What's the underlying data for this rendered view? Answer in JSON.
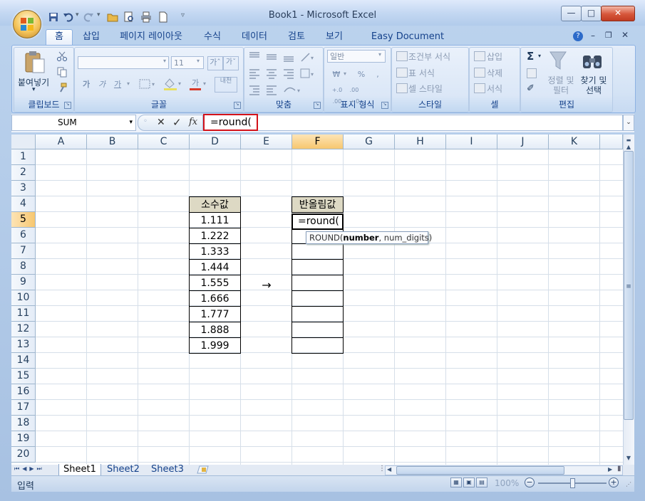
{
  "window": {
    "title": "Book1 - Microsoft Excel",
    "buttons": {
      "minimize": "—",
      "maximize": "□",
      "close": "✕"
    }
  },
  "quick_access": {
    "save": "save-icon",
    "undo": "undo-icon",
    "redo": "redo-icon",
    "open": "open-icon",
    "preview": "print-preview-icon",
    "print": "print-icon",
    "new": "new-document-icon"
  },
  "ribbon": {
    "tabs": [
      "홈",
      "삽입",
      "페이지 레이아웃",
      "수식",
      "데이터",
      "검토",
      "보기",
      "Easy Document Creator"
    ],
    "active_tab": "홈",
    "groups": {
      "clipboard": {
        "label": "클립보드",
        "paste": "붙여넣기",
        "paste_arrow": "▾"
      },
      "font": {
        "label": "글꼴",
        "font_name": "",
        "font_size": "11",
        "grow": "가ˆ",
        "shrink": "가ˇ",
        "bold": "가",
        "italic": "가",
        "underline": "가",
        "font_color_letter": "가",
        "phonetic": "내천"
      },
      "alignment": {
        "label": "맞춤"
      },
      "number": {
        "label": "표시 형식",
        "format": "일반",
        "currency": "₩",
        "percent": "%",
        "comma": ",",
        "inc_dec": "+.0 .00",
        "dec_dec": ".00 →.0"
      },
      "styles": {
        "label": "스타일",
        "conditional": "조건부 서식",
        "table": "표 서식",
        "cell_style": "셀 스타일"
      },
      "cells": {
        "label": "셀",
        "insert": "삽입",
        "delete": "삭제",
        "format": "서식"
      },
      "editing": {
        "label": "편집",
        "autosum": "Σ",
        "sort_filter": "정렬 및 필터",
        "find_select": "찾기 및 선택"
      }
    }
  },
  "formula_bar": {
    "name_box": "SUM",
    "cancel": "✕",
    "enter": "✓",
    "fx": "fx",
    "formula": "=round("
  },
  "grid": {
    "columns": [
      "A",
      "B",
      "C",
      "D",
      "E",
      "F",
      "G",
      "H",
      "I",
      "J",
      "K"
    ],
    "selected_column": "F",
    "rows": [
      "1",
      "2",
      "3",
      "4",
      "5",
      "6",
      "7",
      "8",
      "9",
      "10",
      "11",
      "12",
      "13",
      "14",
      "15",
      "16",
      "17",
      "18",
      "19",
      "20"
    ],
    "selected_row": "5",
    "decimal_header": "소수값",
    "rounded_header": "반올림값",
    "decimal_values": [
      "1.111",
      "1.222",
      "1.333",
      "1.444",
      "1.555",
      "1.666",
      "1.777",
      "1.888",
      "1.999"
    ],
    "arrow": "→",
    "active_cell_text": "=round(",
    "tooltip": {
      "func": "ROUND(",
      "arg1": "number",
      "rest": ", num_digits)"
    }
  },
  "sheet_tabs": [
    "Sheet1",
    "Sheet2",
    "Sheet3"
  ],
  "active_sheet": "Sheet1",
  "status_bar": {
    "mode": "입력",
    "zoom": "100%"
  }
}
